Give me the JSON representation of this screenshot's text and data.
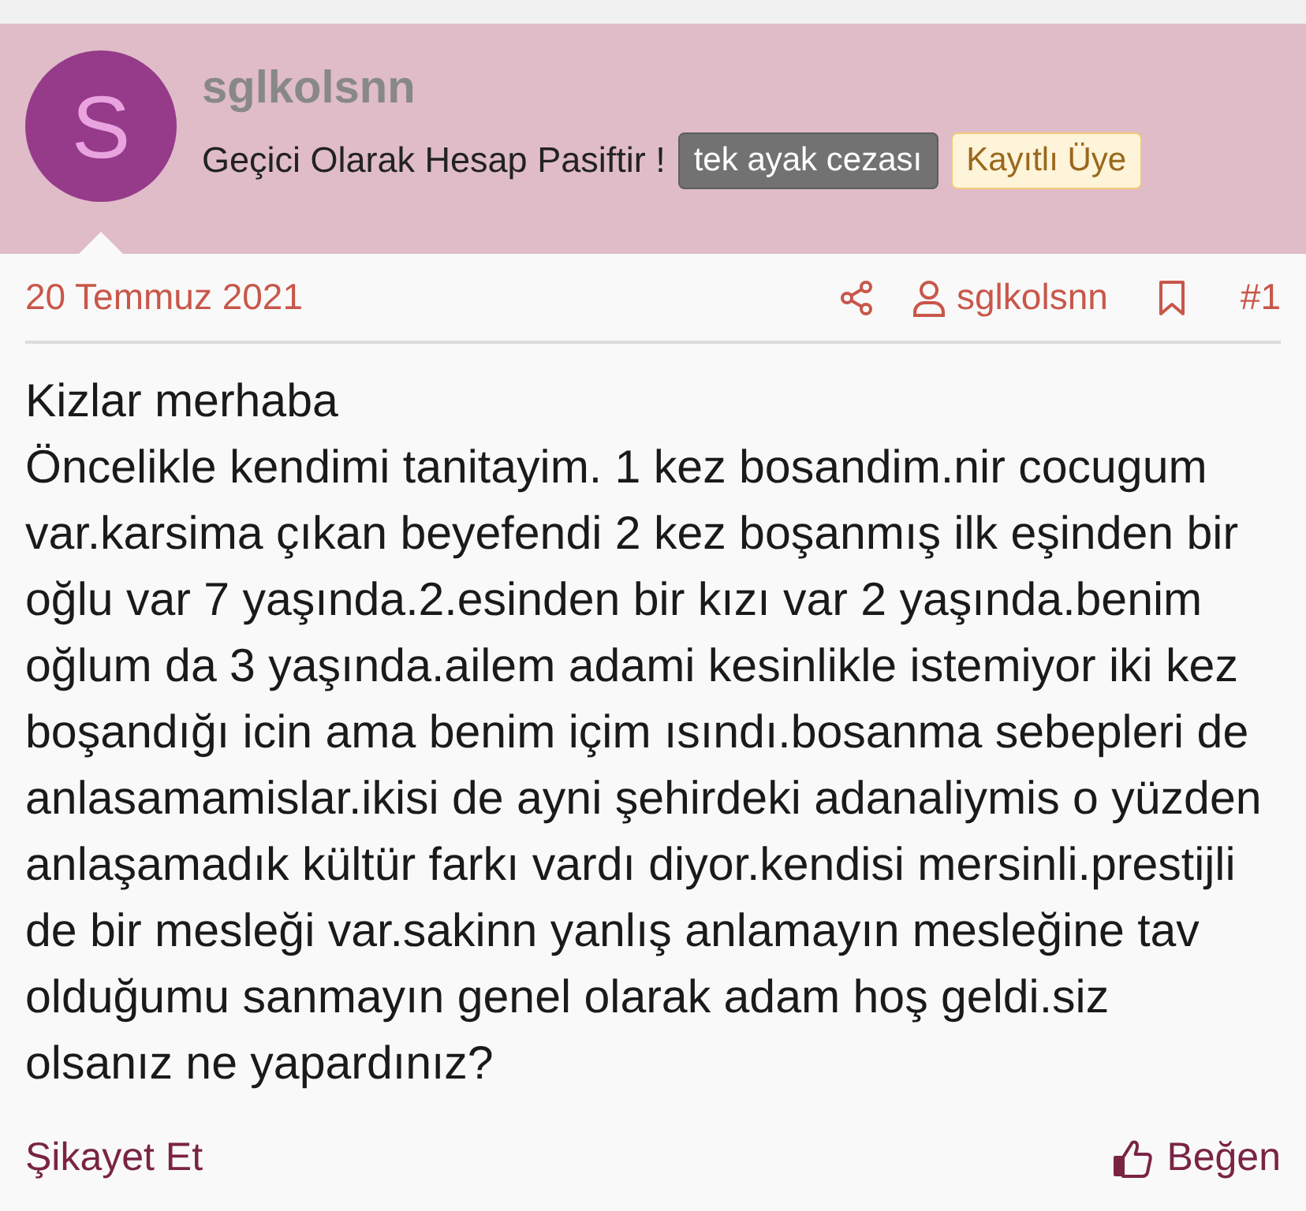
{
  "post": {
    "author": {
      "avatar_letter": "S",
      "username": "sglkolsnn",
      "status": "Geçici Olarak Hesap Pasiftir !",
      "badges": [
        {
          "label": "tek ayak cezası",
          "kind": "dark"
        },
        {
          "label": "Kayıtlı Üye",
          "kind": "member"
        }
      ]
    },
    "meta": {
      "date": "20 Temmuz 2021",
      "author_link": "sglkolsnn",
      "post_number": "#1"
    },
    "body": [
      "Kizlar merhaba",
      "Öncelikle kendimi tanitayim. 1 kez bosandim.nir cocugum var.karsima çıkan beyefendi 2 kez boşanmış ilk eşinden bir oğlu var 7 yaşında.2.esinden bir kızı var 2 yaşında.benim oğlum da 3 yaşında.ailem adami kesinlikle istemiyor iki kez boşandığı icin ama benim içim ısındı.bosanma sebepleri de anlasamamislar.ikisi de ayni şehirdeki adanaliymis o yüzden anlaşamadık kültür farkı vardı diyor.kendisi mersinli.prestijli de bir mesleği var.sakinn yanlış anlamayın mesleğine tav olduğumu sanmayın genel olarak adam hoş geldi.siz olsanız ne yapardınız?"
    ],
    "actions": {
      "report": "Şikayet Et",
      "like": "Beğen"
    }
  }
}
